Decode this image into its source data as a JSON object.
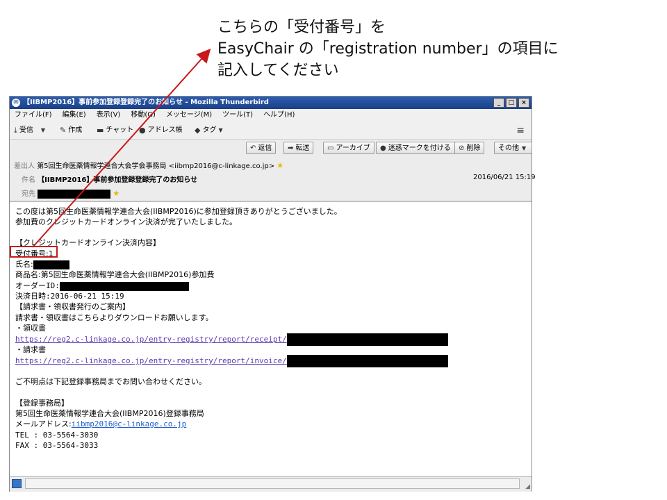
{
  "annotation": {
    "line1": "こちらの「受付番号」を",
    "line2": "EasyChair の「registration number」の項目に",
    "line3": "記入してください"
  },
  "window": {
    "title": "【IIBMP2016】事前参加登録登録完了のお知らせ - Mozilla Thunderbird",
    "minimize": "_",
    "maximize": "□",
    "close": "×"
  },
  "menu": [
    "ファイル(F)",
    "編集(E)",
    "表示(V)",
    "移動(G)",
    "メッセージ(M)",
    "ツール(T)",
    "ヘルプ(H)"
  ],
  "toolbar": {
    "get_mail": "受信",
    "write": "作成",
    "chat": "チャット",
    "address_book": "アドレス帳",
    "tag": "タグ"
  },
  "actions": {
    "reply": "返信",
    "forward": "転送",
    "archive": "アーカイブ",
    "junk": "迷惑マークを付ける",
    "delete": "削除",
    "other": "その他"
  },
  "header": {
    "from_label": "差出人",
    "from_value": "第5回生命医薬情報学連合大会学会事務局 <iibmp2016@c-linkage.co.jp>",
    "subject_label": "件名",
    "subject_value": "【IIBMP2016】事前参加登録登録完了のお知らせ",
    "date": "2016/06/21 15:19",
    "to_label": "宛先"
  },
  "body": {
    "l1": "この度は第5回生命医薬情報学連合大会(IIBMP2016)に参加登録頂きありがとうございました。",
    "l2": "参加費のクレジットカードオンライン決済が完了いたしました。",
    "l3": "【クレジットカードオンライン決済内容】",
    "l4": "受付番号:1",
    "l5": "氏名:",
    "l6": "商品名:第5回生命医薬情報学連合大会(IIBMP2016)参加費",
    "l7": "オーダーID:",
    "l8": "決済日時:2016-06-21 15:19",
    "l9": "【請求書・領収書発行のご案内】",
    "l10": "請求書・領収書はこちらよりダウンロードお願いします。",
    "l11": "・領収書",
    "l12": "https://reg2.c-linkage.co.jp/entry-registry/report/receipt/",
    "l13": "・請求書",
    "l14": "https://reg2.c-linkage.co.jp/entry-registry/report/invoice/",
    "l15": "ご不明点は下記登録事務局までお問い合わせください。",
    "l16": "【登録事務局】",
    "l17": "第5回生命医薬情報学連合大会(IIBMP2016)登録事務局",
    "l18a": "メールアドレス:",
    "l18b": "iibmp2016@c-linkage.co.jp",
    "l19": "TEL : 03-5564-3030",
    "l20": "FAX : 03-5564-3033"
  },
  "colors": {
    "highlight": "#c81818",
    "arrow": "#c81818",
    "titlebar": "#1b3f86",
    "link": "#5b3bb0"
  }
}
